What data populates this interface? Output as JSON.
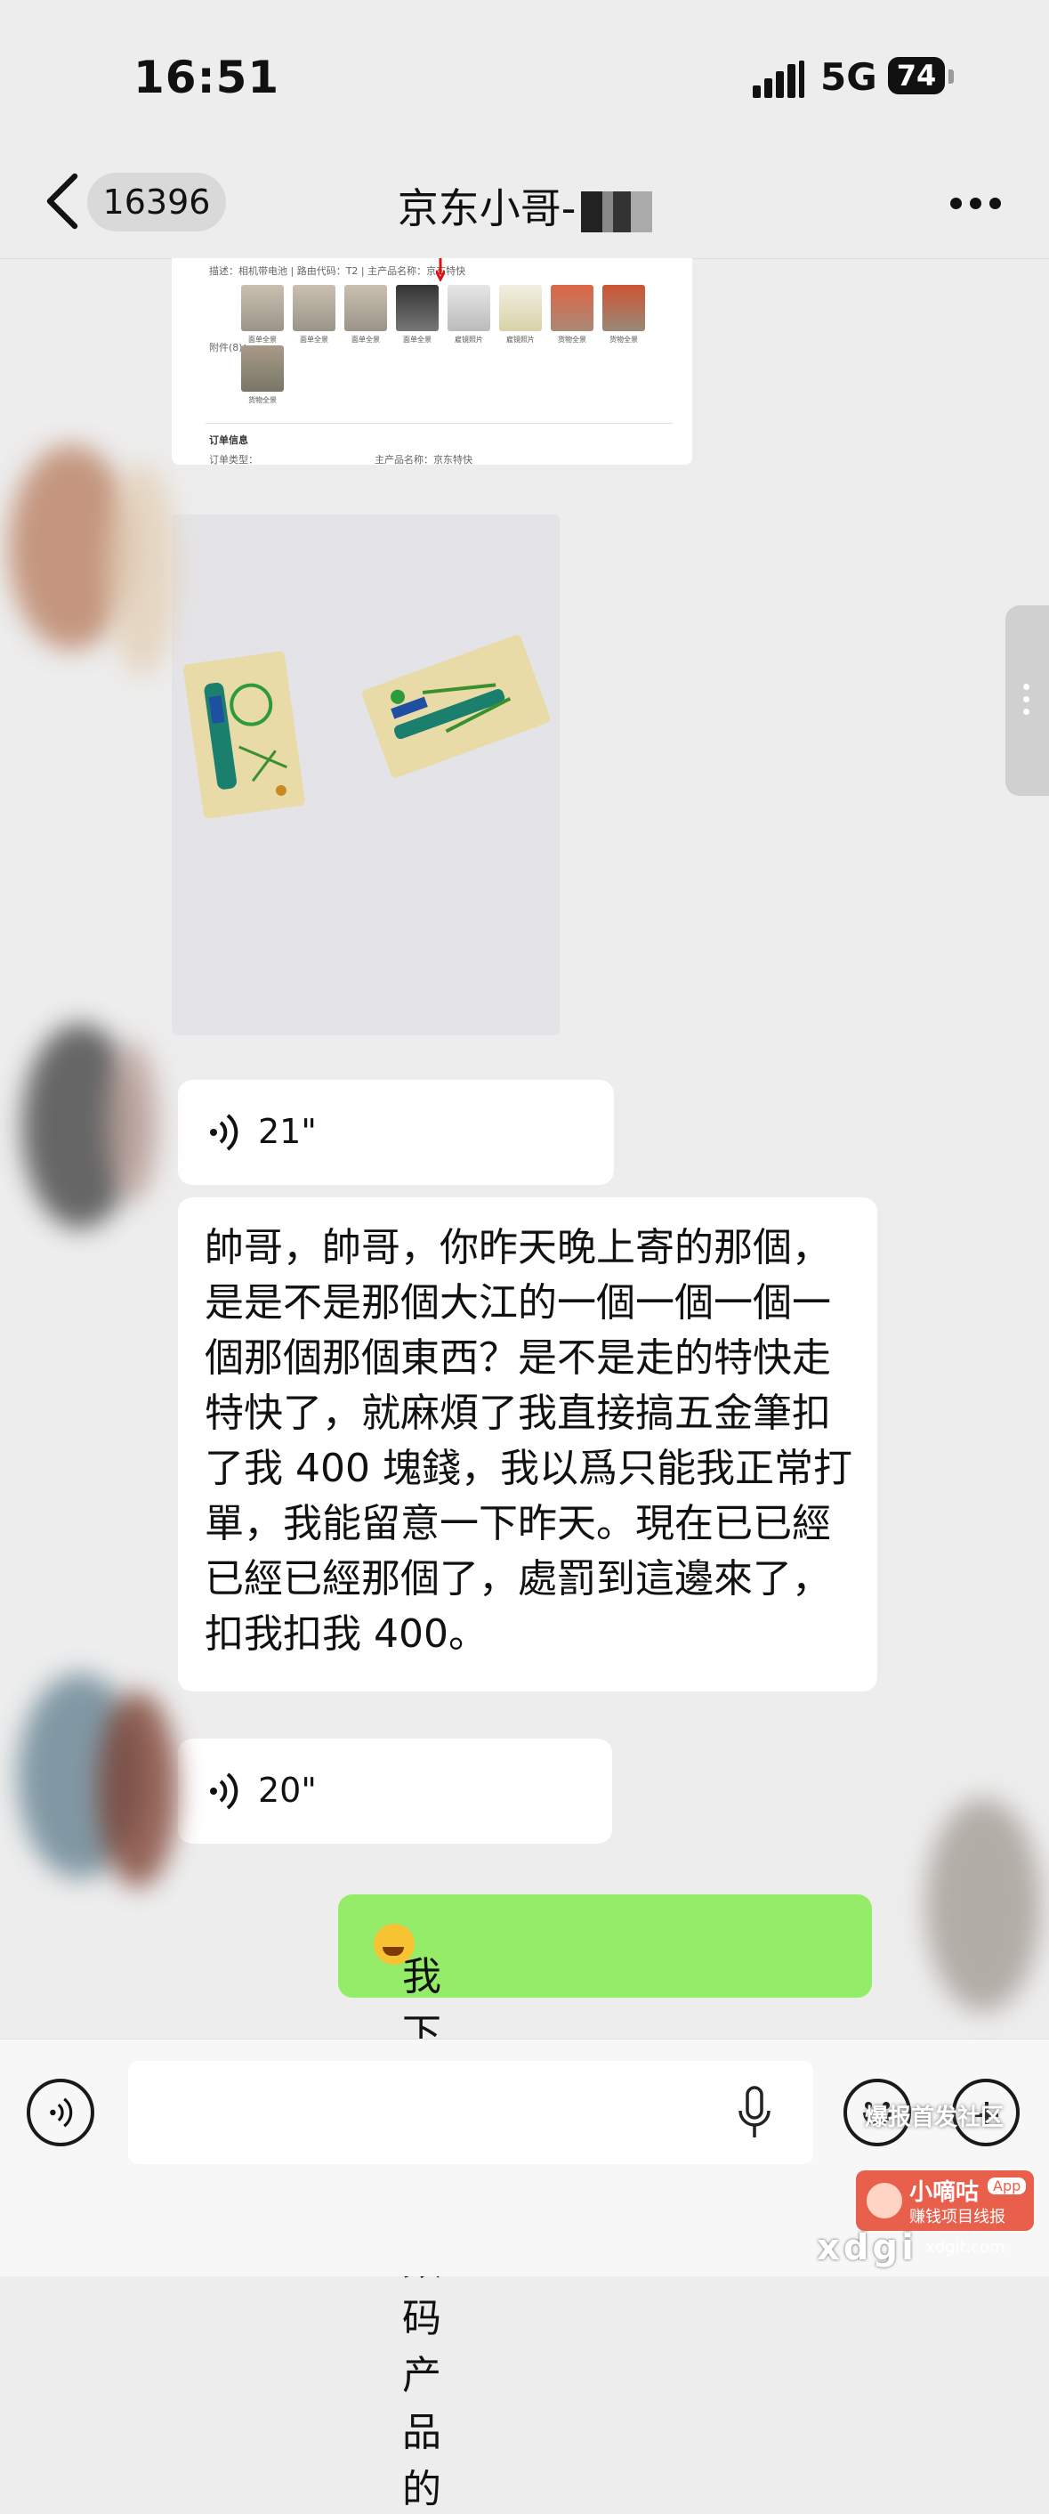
{
  "status_bar": {
    "time": "16:51",
    "network": "5G",
    "battery": "74",
    "signal_icon": "signal-bars-icon"
  },
  "nav": {
    "back_icon": "chevron-left-icon",
    "unread_count": "16396",
    "title": "京东小哥-",
    "more_icon": "more-dots-icon"
  },
  "doc_preview": {
    "desc_line": "描述：相机带电池 | 路由代码：T2 | 主产品名称：京东特快",
    "attach_label": "附件(8)：",
    "thumb_captions": [
      "面单全景",
      "面单全景",
      "面单全景",
      "面单全景",
      "雇镜照片",
      "雇镜照片",
      "货物全景",
      "货物全景",
      "货物全景"
    ],
    "section_title": "订单信息",
    "order_type_label": "订单类型：",
    "product_name_label": "主产品名称：京东特快"
  },
  "messages": {
    "voice1_duration": "21\"",
    "text_message": "帥哥，帥哥，你昨天晚上寄的那個，是是不是那個大江的一個一個一個一個那個那個東西？是不是走的特快走特快了，就麻煩了我直接搞五金筆扣了我 400 塊錢，我以爲只能我正常打單，我能留意一下昨天。現在已已經已經已經那個了，處罰到這邊來了，扣我扣我 400。",
    "voice2_duration": "20\"",
    "my_reply": "我下单选了数码产品的",
    "reply_emoji": "facepalm-emoji-icon"
  },
  "input_bar": {
    "voice_toggle_icon": "voice-mode-icon",
    "mic_icon": "microphone-icon",
    "emoji_icon": "emoji-face-icon",
    "plus_icon": "plus-icon",
    "input_value": ""
  },
  "watermark": {
    "top_text": "爆报首发社区",
    "brand": "小嘀咕",
    "app_badge": "App",
    "slogan": "赚钱项目线报",
    "site_big": "xdgi",
    "site_url": "xdgit.com",
    "brand_color": "#e8604c"
  },
  "colors": {
    "background": "#ededed",
    "my_bubble": "#95ec69",
    "other_bubble": "#ffffff"
  }
}
